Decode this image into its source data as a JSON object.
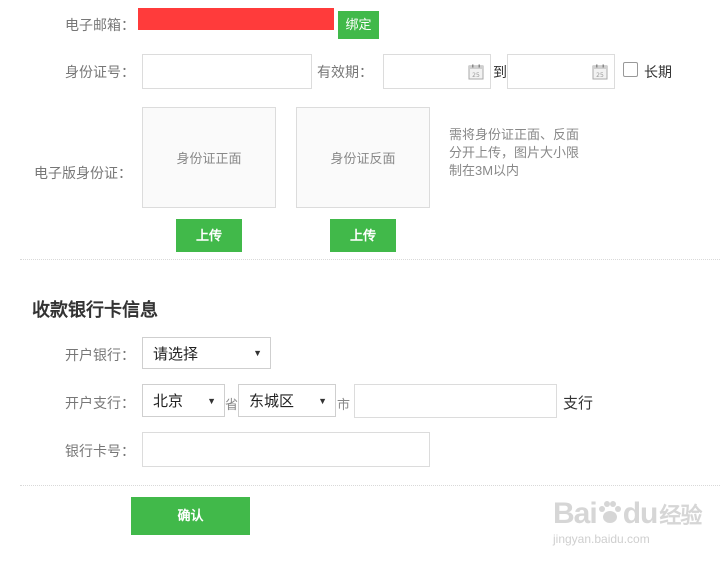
{
  "email": {
    "label": "电子邮箱：",
    "bind_button": "绑定",
    "redaction_color": "#ff3b3b"
  },
  "id_number": {
    "label": "身份证号：",
    "value": "",
    "validity_label": "有效期：",
    "date_from": "",
    "to_label": "到",
    "date_to": "",
    "long_term_label": "长期",
    "long_term_checked": false
  },
  "id_upload": {
    "label": "电子版身份证：",
    "front_placeholder": "身份证正面",
    "back_placeholder": "身份证反面",
    "upload_button": "上传",
    "note": "需将身份证正面、反面\n分开上传，图片大小限\n制在3M以内"
  },
  "bank_section": {
    "title": "收款银行卡信息",
    "bank_label": "开户银行：",
    "bank_selected": "请选择",
    "branch_label": "开户支行：",
    "province_selected": "北京",
    "province_suffix": "省",
    "city_selected": "东城区",
    "city_suffix": "市",
    "branch_value": "",
    "branch_suffix": "支行",
    "card_label": "银行卡号：",
    "card_value": ""
  },
  "confirm_button": "确认",
  "watermark": {
    "text_latin_1": "Bai",
    "text_latin_2": "du",
    "text_cn": "经验",
    "url": "jingyan.baidu.com"
  },
  "colors": {
    "accent": "#41b94a",
    "label_text": "#777777",
    "border": "#dcdcdc"
  }
}
